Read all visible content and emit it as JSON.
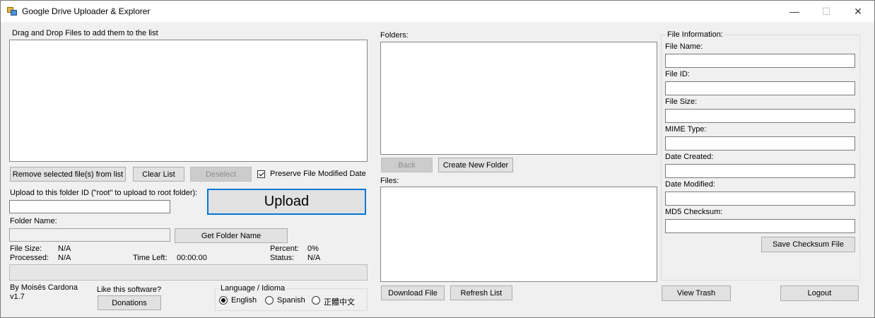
{
  "window": {
    "title": "Google Drive Uploader & Explorer",
    "controls": {
      "minimize": "—",
      "maximize": "☐",
      "close": "✕"
    }
  },
  "left": {
    "dropzone_label": "Drag and Drop Files to add them to the list",
    "remove_button": "Remove selected file(s) from list",
    "clear_button": "Clear List",
    "deselect_button": "Deselect",
    "preserve_label": "Preserve File Modified Date",
    "preserve_checked": true,
    "folder_id_label": "Upload to this folder ID (\"root\" to upload to root folder):",
    "folder_id_value": "",
    "upload_button": "Upload",
    "folder_name_label": "Folder Name:",
    "folder_name_value": "",
    "get_folder_name_button": "Get Folder Name",
    "stats": {
      "file_size_label": "File Size:",
      "file_size_value": "N/A",
      "processed_label": "Processed:",
      "processed_value": "N/A",
      "time_left_label": "Time Left:",
      "time_left_value": "00:00:00",
      "percent_label": "Percent:",
      "percent_value": "0%",
      "status_label": "Status:",
      "status_value": "N/A"
    },
    "progress": 0,
    "author": "By Moisés Cardona",
    "version": "v1.7",
    "like_label": "Like this software?",
    "donations_button": "Donations",
    "language": {
      "title": "Language / Idioma",
      "options": [
        "English",
        "Spanish",
        "正體中文"
      ],
      "selected": "English"
    }
  },
  "middle": {
    "folders_label": "Folders:",
    "back_button": "Back",
    "create_folder_button": "Create New Folder",
    "files_label": "Files:",
    "download_button": "Download File",
    "refresh_button": "Refresh List"
  },
  "right": {
    "group_title": "File Information:",
    "fields": [
      {
        "label": "File Name:",
        "value": ""
      },
      {
        "label": "File ID:",
        "value": ""
      },
      {
        "label": "File Size:",
        "value": ""
      },
      {
        "label": "MIME Type:",
        "value": ""
      },
      {
        "label": "Date Created:",
        "value": ""
      },
      {
        "label": "Date Modified:",
        "value": ""
      },
      {
        "label": "MD5 Checksum:",
        "value": ""
      }
    ],
    "save_checksum_button": "Save Checksum File",
    "view_trash_button": "View Trash",
    "logout_button": "Logout"
  }
}
